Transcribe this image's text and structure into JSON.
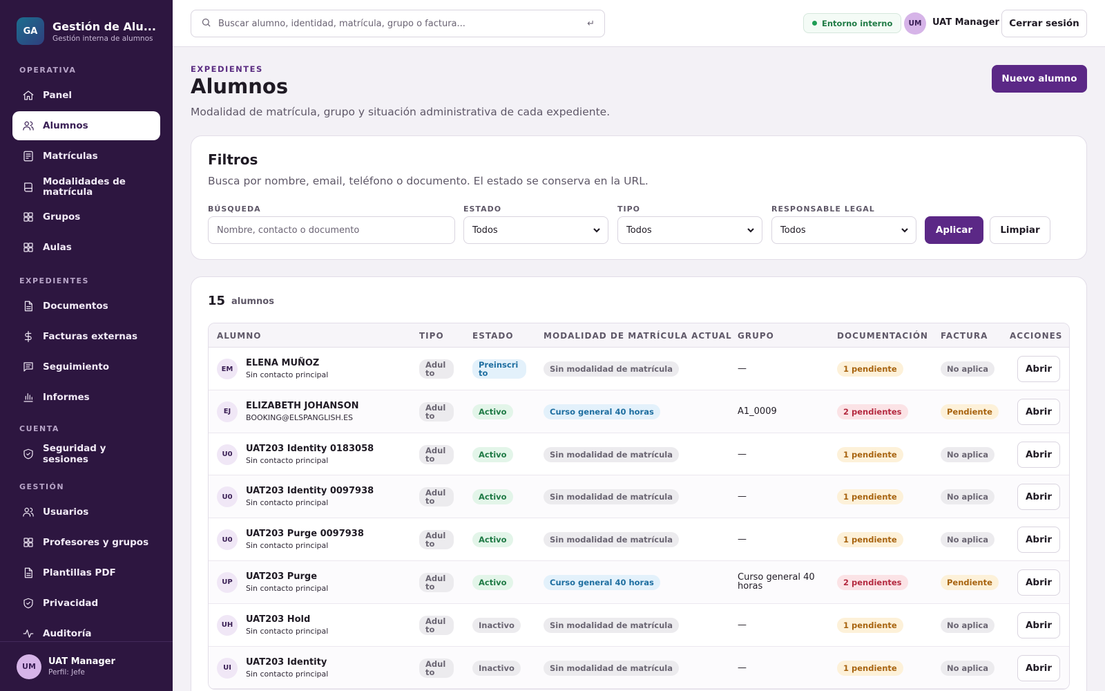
{
  "brand": {
    "initials": "GA",
    "title": "Gestión de Alu...",
    "subtitle": "Gestión interna de alumnos"
  },
  "sidebar": {
    "sections": [
      {
        "label": "OPERATIVA",
        "items": [
          {
            "label": "Panel",
            "icon": "home-icon"
          },
          {
            "label": "Alumnos",
            "icon": "users-icon",
            "active": true
          },
          {
            "label": "Matrículas",
            "icon": "form-icon"
          },
          {
            "label": "Modalidades de matrícula",
            "icon": "book-icon"
          },
          {
            "label": "Grupos",
            "icon": "grid-icon"
          },
          {
            "label": "Aulas",
            "icon": "grid-icon"
          }
        ]
      },
      {
        "label": "EXPEDIENTES",
        "items": [
          {
            "label": "Documentos",
            "icon": "document-icon"
          },
          {
            "label": "Facturas externas",
            "icon": "dollar-icon"
          },
          {
            "label": "Seguimiento",
            "icon": "message-icon"
          },
          {
            "label": "Informes",
            "icon": "bar-chart-icon"
          }
        ]
      },
      {
        "label": "CUENTA",
        "items": [
          {
            "label": "Seguridad y sesiones",
            "icon": "shield-icon"
          }
        ]
      },
      {
        "label": "GESTIÓN",
        "items": [
          {
            "label": "Usuarios",
            "icon": "users-icon"
          },
          {
            "label": "Profesores y grupos",
            "icon": "grid-icon"
          },
          {
            "label": "Plantillas PDF",
            "icon": "document-icon"
          },
          {
            "label": "Privacidad",
            "icon": "shield-icon"
          },
          {
            "label": "Auditoría",
            "icon": "activity-icon"
          }
        ]
      }
    ],
    "footer": {
      "initials": "UM",
      "name": "UAT Manager",
      "role": "Perfil: Jefe"
    }
  },
  "topbar": {
    "search_placeholder": "Buscar alumno, identidad, matrícula, grupo o factura...",
    "search_hint": "↵",
    "env_label": "Entorno interno",
    "user_initials": "UM",
    "user_name": "UAT Manager",
    "logout_label": "Cerrar sesión"
  },
  "header": {
    "eyebrow": "EXPEDIENTES",
    "title": "Alumnos",
    "subtitle": "Modalidad de matrícula, grupo y situación administrativa de cada expediente.",
    "new_button": "Nuevo alumno"
  },
  "filters": {
    "title": "Filtros",
    "subtitle": "Busca por nombre, email, teléfono o documento. El estado se conserva en la URL.",
    "search_label": "BÚSQUEDA",
    "search_placeholder": "Nombre, contacto o documento",
    "estado_label": "ESTADO",
    "estado_value": "Todos",
    "tipo_label": "TIPO",
    "tipo_value": "Todos",
    "responsable_label": "RESPONSABLE LEGAL",
    "responsable_value": "Todos",
    "apply_label": "Aplicar",
    "clear_label": "Limpiar"
  },
  "results": {
    "count": "15",
    "count_label": "alumnos",
    "columns": [
      "ALUMNO",
      "TIPO",
      "ESTADO",
      "MODALIDAD DE MATRÍCULA ACTUAL",
      "GRUPO",
      "DOCUMENTACIÓN",
      "FACTURA",
      "ACCIONES"
    ],
    "rows": [
      {
        "initials": "EM",
        "name": "ELENA MUÑOZ",
        "contact": "Sin contacto principal",
        "tipo": "Adulto",
        "estado": "Preinscrito",
        "estado_color": "blue",
        "modalidad": "Sin modalidad de matrícula",
        "modalidad_color": "grey",
        "grupo": "—",
        "doc": "1 pendiente",
        "doc_color": "amber",
        "factura": "No aplica",
        "factura_color": "grey",
        "action": "Abrir"
      },
      {
        "initials": "EJ",
        "name": "ELIZABETH JOHANSON",
        "contact": "BOOKING@ELSPANGLISH.ES",
        "tipo": "Adulto",
        "estado": "Activo",
        "estado_color": "green",
        "modalidad": "Curso general 40 horas",
        "modalidad_color": "blue",
        "grupo": "A1_0009",
        "doc": "2 pendientes",
        "doc_color": "red",
        "factura": "Pendiente",
        "factura_color": "amber",
        "action": "Abrir"
      },
      {
        "initials": "U0",
        "name": "UAT203 Identity 0183058",
        "contact": "Sin contacto principal",
        "tipo": "Adulto",
        "estado": "Activo",
        "estado_color": "green",
        "modalidad": "Sin modalidad de matrícula",
        "modalidad_color": "grey",
        "grupo": "—",
        "doc": "1 pendiente",
        "doc_color": "amber",
        "factura": "No aplica",
        "factura_color": "grey",
        "action": "Abrir"
      },
      {
        "initials": "U0",
        "name": "UAT203 Identity 0097938",
        "contact": "Sin contacto principal",
        "tipo": "Adulto",
        "estado": "Activo",
        "estado_color": "green",
        "modalidad": "Sin modalidad de matrícula",
        "modalidad_color": "grey",
        "grupo": "—",
        "doc": "1 pendiente",
        "doc_color": "amber",
        "factura": "No aplica",
        "factura_color": "grey",
        "action": "Abrir"
      },
      {
        "initials": "U0",
        "name": "UAT203 Purge 0097938",
        "contact": "Sin contacto principal",
        "tipo": "Adulto",
        "estado": "Activo",
        "estado_color": "green",
        "modalidad": "Sin modalidad de matrícula",
        "modalidad_color": "grey",
        "grupo": "—",
        "doc": "1 pendiente",
        "doc_color": "amber",
        "factura": "No aplica",
        "factura_color": "grey",
        "action": "Abrir"
      },
      {
        "initials": "UP",
        "name": "UAT203 Purge",
        "contact": "Sin contacto principal",
        "tipo": "Adulto",
        "estado": "Activo",
        "estado_color": "green",
        "modalidad": "Curso general 40 horas",
        "modalidad_color": "blue",
        "grupo": "Curso general 40 horas",
        "doc": "2 pendientes",
        "doc_color": "red",
        "factura": "Pendiente",
        "factura_color": "amber",
        "action": "Abrir"
      },
      {
        "initials": "UH",
        "name": "UAT203 Hold",
        "contact": "Sin contacto principal",
        "tipo": "Adulto",
        "estado": "Inactivo",
        "estado_color": "grey",
        "modalidad": "Sin modalidad de matrícula",
        "modalidad_color": "grey",
        "grupo": "—",
        "doc": "1 pendiente",
        "doc_color": "amber",
        "factura": "No aplica",
        "factura_color": "grey",
        "action": "Abrir"
      },
      {
        "initials": "UI",
        "name": "UAT203 Identity",
        "contact": "Sin contacto principal",
        "tipo": "Adulto",
        "estado": "Inactivo",
        "estado_color": "grey",
        "modalidad": "Sin modalidad de matrícula",
        "modalidad_color": "grey",
        "grupo": "—",
        "doc": "1 pendiente",
        "doc_color": "amber",
        "factura": "No aplica",
        "factura_color": "grey",
        "action": "Abrir"
      }
    ]
  },
  "colors": {
    "sidebar_bg": "#2d1640",
    "accent": "#5b2886",
    "page_bg": "#f3f1f6"
  }
}
